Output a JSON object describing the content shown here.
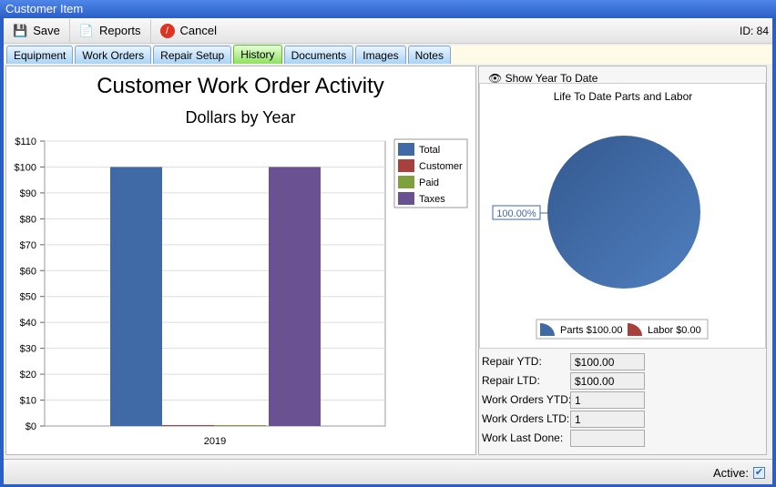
{
  "window": {
    "title": "Customer Item"
  },
  "toolbar": {
    "save": "Save",
    "reports": "Reports",
    "cancel": "Cancel",
    "id": "ID: 84"
  },
  "tabs": [
    "Equipment",
    "Work Orders",
    "Repair Setup",
    "History",
    "Documents",
    "Images",
    "Notes"
  ],
  "active_tab": "History",
  "show_ytd": "Show Year To Date",
  "chart_data": [
    {
      "type": "bar",
      "title": "Customer Work Order Activity",
      "subtitle": "Dollars by Year",
      "categories": [
        "2019"
      ],
      "series": [
        {
          "name": "Total",
          "values": [
            100
          ],
          "color": "#3f6aa6"
        },
        {
          "name": "Customer",
          "values": [
            0
          ],
          "color": "#a8413d"
        },
        {
          "name": "Paid",
          "values": [
            0
          ],
          "color": "#7fa13d"
        },
        {
          "name": "Taxes",
          "values": [
            100
          ],
          "color": "#6a5192"
        }
      ],
      "ylim": [
        0,
        110
      ],
      "yticks": [
        "$0",
        "$10",
        "$20",
        "$30",
        "$40",
        "$50",
        "$60",
        "$70",
        "$80",
        "$90",
        "$100",
        "$110"
      ],
      "legend": "top-right",
      "grid": true
    },
    {
      "type": "pie",
      "title": "Life To Date Parts and Labor",
      "slices": [
        {
          "name": "Parts $100.00",
          "value": 100,
          "color": "#3f6aa6"
        },
        {
          "name": "Labor $0.00",
          "value": 0,
          "color": "#a8413d"
        }
      ],
      "data_label": "100.00%",
      "legend": "bottom"
    }
  ],
  "stats": [
    {
      "label": "Repair YTD:",
      "value": "$100.00"
    },
    {
      "label": "Repair LTD:",
      "value": "$100.00"
    },
    {
      "label": "Work Orders YTD:",
      "value": "1"
    },
    {
      "label": "Work Orders LTD:",
      "value": "1"
    },
    {
      "label": "Work Last Done:",
      "value": ""
    }
  ],
  "status": {
    "active_label": "Active:",
    "active": true
  }
}
